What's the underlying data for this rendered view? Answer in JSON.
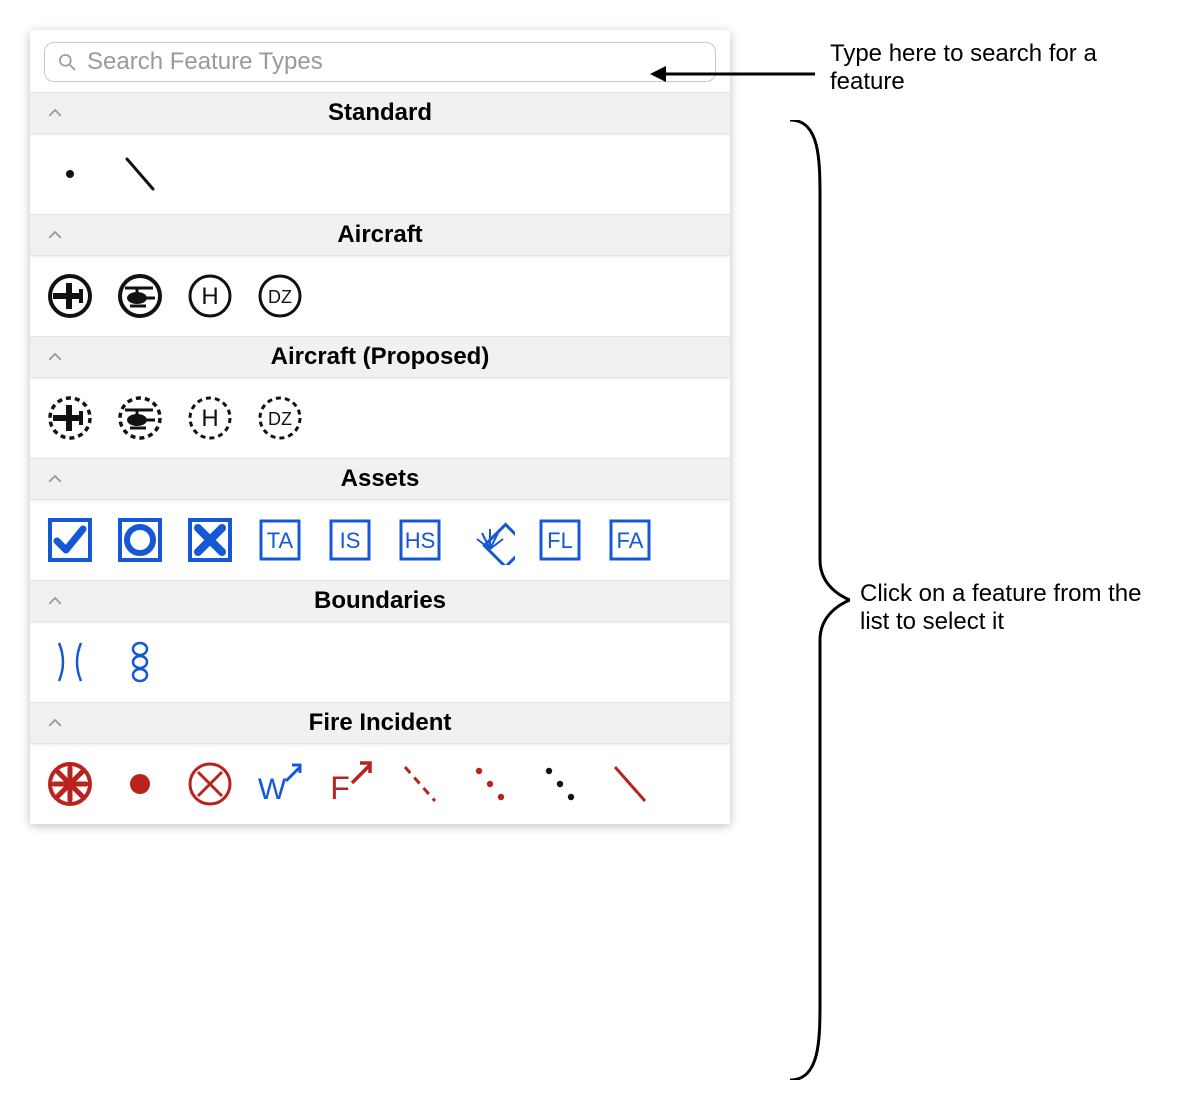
{
  "search": {
    "placeholder": "Search Feature Types"
  },
  "sections": [
    {
      "title": "Standard",
      "items": [
        {
          "name": "point-icon"
        },
        {
          "name": "line-icon"
        }
      ]
    },
    {
      "title": "Aircraft",
      "items": [
        {
          "name": "fixed-wing-icon"
        },
        {
          "name": "helicopter-icon"
        },
        {
          "name": "helipad-h-icon",
          "label": "H"
        },
        {
          "name": "drop-zone-icon",
          "label": "DZ"
        }
      ]
    },
    {
      "title": "Aircraft (Proposed)",
      "items": [
        {
          "name": "fixed-wing-proposed-icon"
        },
        {
          "name": "helicopter-proposed-icon"
        },
        {
          "name": "helipad-h-proposed-icon",
          "label": "H"
        },
        {
          "name": "drop-zone-proposed-icon",
          "label": "DZ"
        }
      ]
    },
    {
      "title": "Assets",
      "items": [
        {
          "name": "asset-check-icon"
        },
        {
          "name": "asset-circle-icon"
        },
        {
          "name": "asset-x-icon"
        },
        {
          "name": "asset-ta-icon",
          "label": "TA"
        },
        {
          "name": "asset-is-icon",
          "label": "IS"
        },
        {
          "name": "asset-hs-icon",
          "label": "HS"
        },
        {
          "name": "asset-fan-icon"
        },
        {
          "name": "asset-fl-icon",
          "label": "FL"
        },
        {
          "name": "asset-fa-icon",
          "label": "FA"
        }
      ]
    },
    {
      "title": "Boundaries",
      "items": [
        {
          "name": "boundary-arc-icon"
        },
        {
          "name": "boundary-chain-icon"
        }
      ]
    },
    {
      "title": "Fire Incident",
      "items": [
        {
          "name": "fire-asterisk-icon"
        },
        {
          "name": "fire-dot-icon"
        },
        {
          "name": "fire-circled-x-icon"
        },
        {
          "name": "fire-w-arrow-icon",
          "label": "W"
        },
        {
          "name": "fire-f-arrow-icon",
          "label": "F"
        },
        {
          "name": "fire-dash-red-icon"
        },
        {
          "name": "fire-dots-red-icon"
        },
        {
          "name": "fire-dots-black-icon"
        },
        {
          "name": "fire-line-red-icon"
        }
      ]
    }
  ],
  "annotations": {
    "search_hint": "Type here to search for a feature",
    "list_hint": "Click on a feature from the list to select it"
  },
  "colors": {
    "asset_blue": "#1558d6",
    "fire_red": "#b8231d",
    "black": "#111111"
  }
}
